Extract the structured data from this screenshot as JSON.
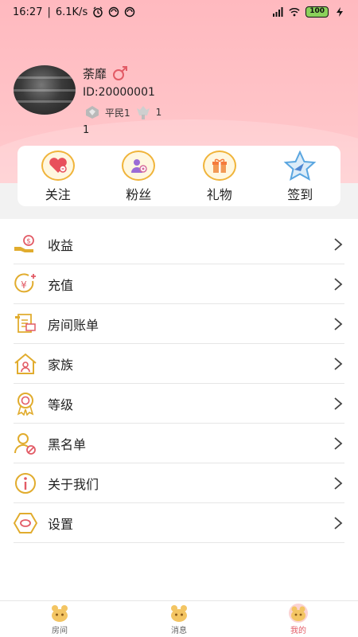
{
  "status_bar": {
    "time": "16:27",
    "speed": "6.1K/s",
    "battery": "100"
  },
  "profile": {
    "name": "荼靡",
    "id_text": "ID:20000001",
    "level_name": "平民1",
    "wealth_level": "1",
    "extra_value": "1"
  },
  "quick_actions": [
    {
      "label": "关注",
      "icon": "heart-icon"
    },
    {
      "label": "粉丝",
      "icon": "fans-icon"
    },
    {
      "label": "礼物",
      "icon": "gift-icon"
    },
    {
      "label": "签到",
      "icon": "star-icon"
    }
  ],
  "menu": [
    {
      "label": "收益",
      "icon": "income-icon"
    },
    {
      "label": "充值",
      "icon": "recharge-icon"
    },
    {
      "label": "房间账单",
      "icon": "bill-icon"
    },
    {
      "label": "家族",
      "icon": "family-icon"
    },
    {
      "label": "等级",
      "icon": "medal-icon"
    },
    {
      "label": "黑名单",
      "icon": "blacklist-icon"
    },
    {
      "label": "关于我们",
      "icon": "info-icon"
    },
    {
      "label": "设置",
      "icon": "settings-icon"
    }
  ],
  "bottom_nav": [
    {
      "label": "房间",
      "icon": "room-icon",
      "active": false
    },
    {
      "label": "消息",
      "icon": "message-icon",
      "active": false
    },
    {
      "label": "我的",
      "icon": "mine-icon",
      "active": true
    }
  ],
  "colors": {
    "header_pink": "#ffc4c8",
    "accent_gold": "#f0b43a",
    "active_red": "#e25b66"
  }
}
